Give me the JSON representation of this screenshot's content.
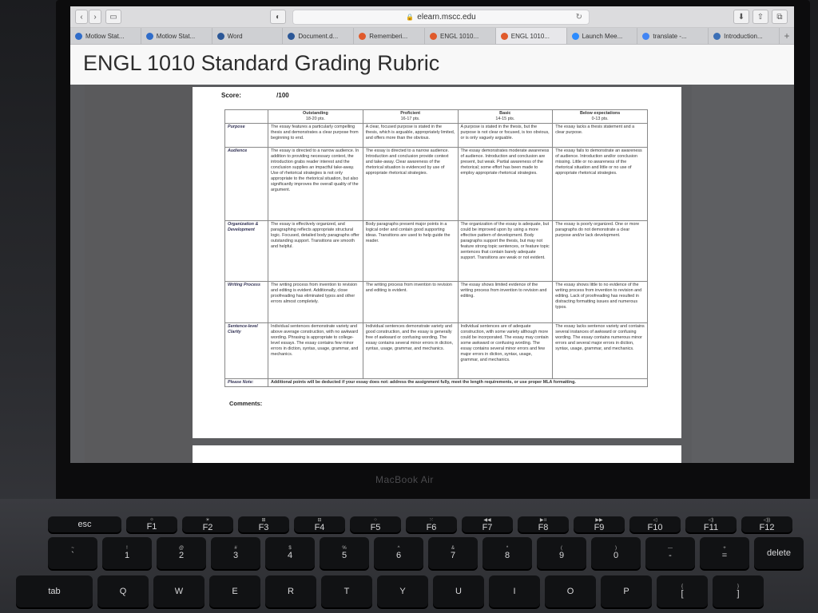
{
  "browser": {
    "url": "elearn.mscc.edu",
    "tabs": [
      {
        "label": "Motlow Stat...",
        "color": "#2f6cc9"
      },
      {
        "label": "Motlow Stat...",
        "color": "#2f6cc9"
      },
      {
        "label": "Word",
        "color": "#2b5797"
      },
      {
        "label": "Document.d...",
        "color": "#2b5797"
      },
      {
        "label": "Rememberi...",
        "color": "#e05a2b"
      },
      {
        "label": "ENGL 1010...",
        "color": "#e05a2b"
      },
      {
        "label": "ENGL 1010...",
        "color": "#e05a2b"
      },
      {
        "label": "Launch Mee...",
        "color": "#2d8cff"
      },
      {
        "label": "translate -...",
        "color": "#4285f4"
      },
      {
        "label": "Introduction...",
        "color": "#3b6fb6"
      }
    ]
  },
  "page": {
    "title": "ENGL 1010 Standard Grading Rubric",
    "score_label": "Score:",
    "score_value": "/100",
    "comments_label": "Comments:"
  },
  "rubric": {
    "levels": [
      {
        "name": "Outstanding",
        "pts": "18-20 pts."
      },
      {
        "name": "Proficient",
        "pts": "16-17 pts."
      },
      {
        "name": "Basic",
        "pts": "14-15 pts."
      },
      {
        "name": "Below expectations",
        "pts": "0-13 pts."
      }
    ],
    "rows": [
      {
        "criterion": "Purpose",
        "cells": [
          "The essay features a particularly compelling thesis and demonstrates a clear purpose from beginning to end.",
          "A clear, focused purpose is stated in the thesis, which is arguable, appropriately limited, and offers more than the obvious.",
          "A purpose is stated in the thesis, but the purpose is not clear or focused, is too obvious, or is only vaguely arguable.",
          "The essay lacks a thesis statement and a clear purpose."
        ]
      },
      {
        "criterion": "Audience",
        "cells": [
          "The essay is directed to a narrow audience. In addition to providing necessary context, the introduction grabs reader interest and the conclusion supplies an impactful take-away. Use of rhetorical strategies is not only appropriate to the rhetorical situation, but also significantly improves the overall quality of the argument.",
          "The essay is directed to a narrow audience. Introduction and conclusion provide context and take-away. Clear awareness of the rhetorical situation is evidenced by use of appropriate rhetorical strategies.",
          "The essay demonstrates moderate awareness of audience. Introduction and conclusion are present, but weak. Partial awareness of the rhetorical; some effort has been made to employ appropriate rhetorical strategies.",
          "The essay fails to demonstrate an awareness of audience. Introduction and/or conclusion missing. Little or no awareness of the rhetorical situation and little or no use of appropriate rhetorical strategies."
        ]
      },
      {
        "criterion": "Organization & Development",
        "cells": [
          "The essay is effectively organized, and paragraphing reflects appropriate structural logic. Focused, detailed body paragraphs offer outstanding support. Transitions are smooth and helpful.",
          "Body paragraphs present major points in a logical order and contain good supporting ideas. Transitions are used to help guide the reader.",
          "The organization of the essay is adequate, but could be improved upon by using a more effective pattern of development. Body paragraphs support the thesis, but may not feature strong topic sentences, or feature topic sentences that contain barely adequate support. Transitions are weak or not evident.",
          "The essay is poorly organized. One or more paragraphs do not demonstrate a clear purpose and/or lack development."
        ]
      },
      {
        "criterion": "Writing Process",
        "cells": [
          "The writing process from invention to revision and editing is evident. Additionally, close proofreading has eliminated typos and other errors almost completely.",
          "The writing process from invention to revision and editing is evident.",
          "The essay shows limited evidence of the writing process from invention to revision and editing.",
          "The essay shows little to no evidence of the writing process from invention to revision and editing. Lack of proofreading has resulted in distracting formatting issues and numerous typos."
        ]
      },
      {
        "criterion": "Sentence-level Clarity",
        "cells": [
          "Individual sentences demonstrate variety and above average construction, with no awkward wording. Phrasing is appropriate to college-level essays. The essay contains few minor errors in diction, syntax, usage, grammar, and mechanics.",
          "Individual sentences demonstrate variety and good construction, and the essay is generally free of awkward or confusing wording. The essay contains several minor errors in diction, syntax, usage, grammar, and mechanics.",
          "Individual sentences are of adequate construction, with some variety although more could be incorporated. The essay may contain some awkward or confusing wording. The essay contains several minor errors and few major errors in diction, syntax, usage, grammar, and mechanics.",
          "The essay lacks sentence variety and contains several instances of awkward or confusing wording. The essay contains numerous minor errors and several major errors in diction, syntax, usage, grammar, and mechanics."
        ]
      }
    ],
    "note_label": "Please Note:",
    "note_text": "Additional points will be deducted if your essay does not: address the assignment fully, meet the length requirements, or use proper MLA formatting."
  },
  "laptop": {
    "brand": "MacBook Air",
    "keys_row1": [
      {
        "top": "",
        "bottom": "esc"
      },
      {
        "top": "☼",
        "bottom": "F1"
      },
      {
        "top": "☀",
        "bottom": "F2"
      },
      {
        "top": "⊞",
        "bottom": "F3"
      },
      {
        "top": "⊟",
        "bottom": "F4"
      },
      {
        "top": "⁘",
        "bottom": "F5"
      },
      {
        "top": "⁙",
        "bottom": "F6"
      },
      {
        "top": "◀◀",
        "bottom": "F7"
      },
      {
        "top": "▶॥",
        "bottom": "F8"
      },
      {
        "top": "▶▶",
        "bottom": "F9"
      },
      {
        "top": "◁",
        "bottom": "F10"
      },
      {
        "top": "◁)",
        "bottom": "F11"
      },
      {
        "top": "◁))",
        "bottom": "F12"
      }
    ],
    "keys_row2": [
      {
        "top": "~",
        "bottom": "`"
      },
      {
        "top": "!",
        "bottom": "1"
      },
      {
        "top": "@",
        "bottom": "2"
      },
      {
        "top": "#",
        "bottom": "3"
      },
      {
        "top": "$",
        "bottom": "4"
      },
      {
        "top": "%",
        "bottom": "5"
      },
      {
        "top": "^",
        "bottom": "6"
      },
      {
        "top": "&",
        "bottom": "7"
      },
      {
        "top": "*",
        "bottom": "8"
      },
      {
        "top": "(",
        "bottom": "9"
      },
      {
        "top": ")",
        "bottom": "0"
      },
      {
        "top": "—",
        "bottom": "-"
      },
      {
        "top": "+",
        "bottom": "="
      },
      {
        "top": "",
        "bottom": "delete"
      }
    ],
    "keys_row3": [
      {
        "top": "",
        "bottom": "tab"
      },
      {
        "top": "",
        "bottom": "Q"
      },
      {
        "top": "",
        "bottom": "W"
      },
      {
        "top": "",
        "bottom": "E"
      },
      {
        "top": "",
        "bottom": "R"
      },
      {
        "top": "",
        "bottom": "T"
      },
      {
        "top": "",
        "bottom": "Y"
      },
      {
        "top": "",
        "bottom": "U"
      },
      {
        "top": "",
        "bottom": "I"
      },
      {
        "top": "",
        "bottom": "O"
      },
      {
        "top": "",
        "bottom": "P"
      },
      {
        "top": "{",
        "bottom": "["
      },
      {
        "top": "}",
        "bottom": "]"
      }
    ]
  }
}
